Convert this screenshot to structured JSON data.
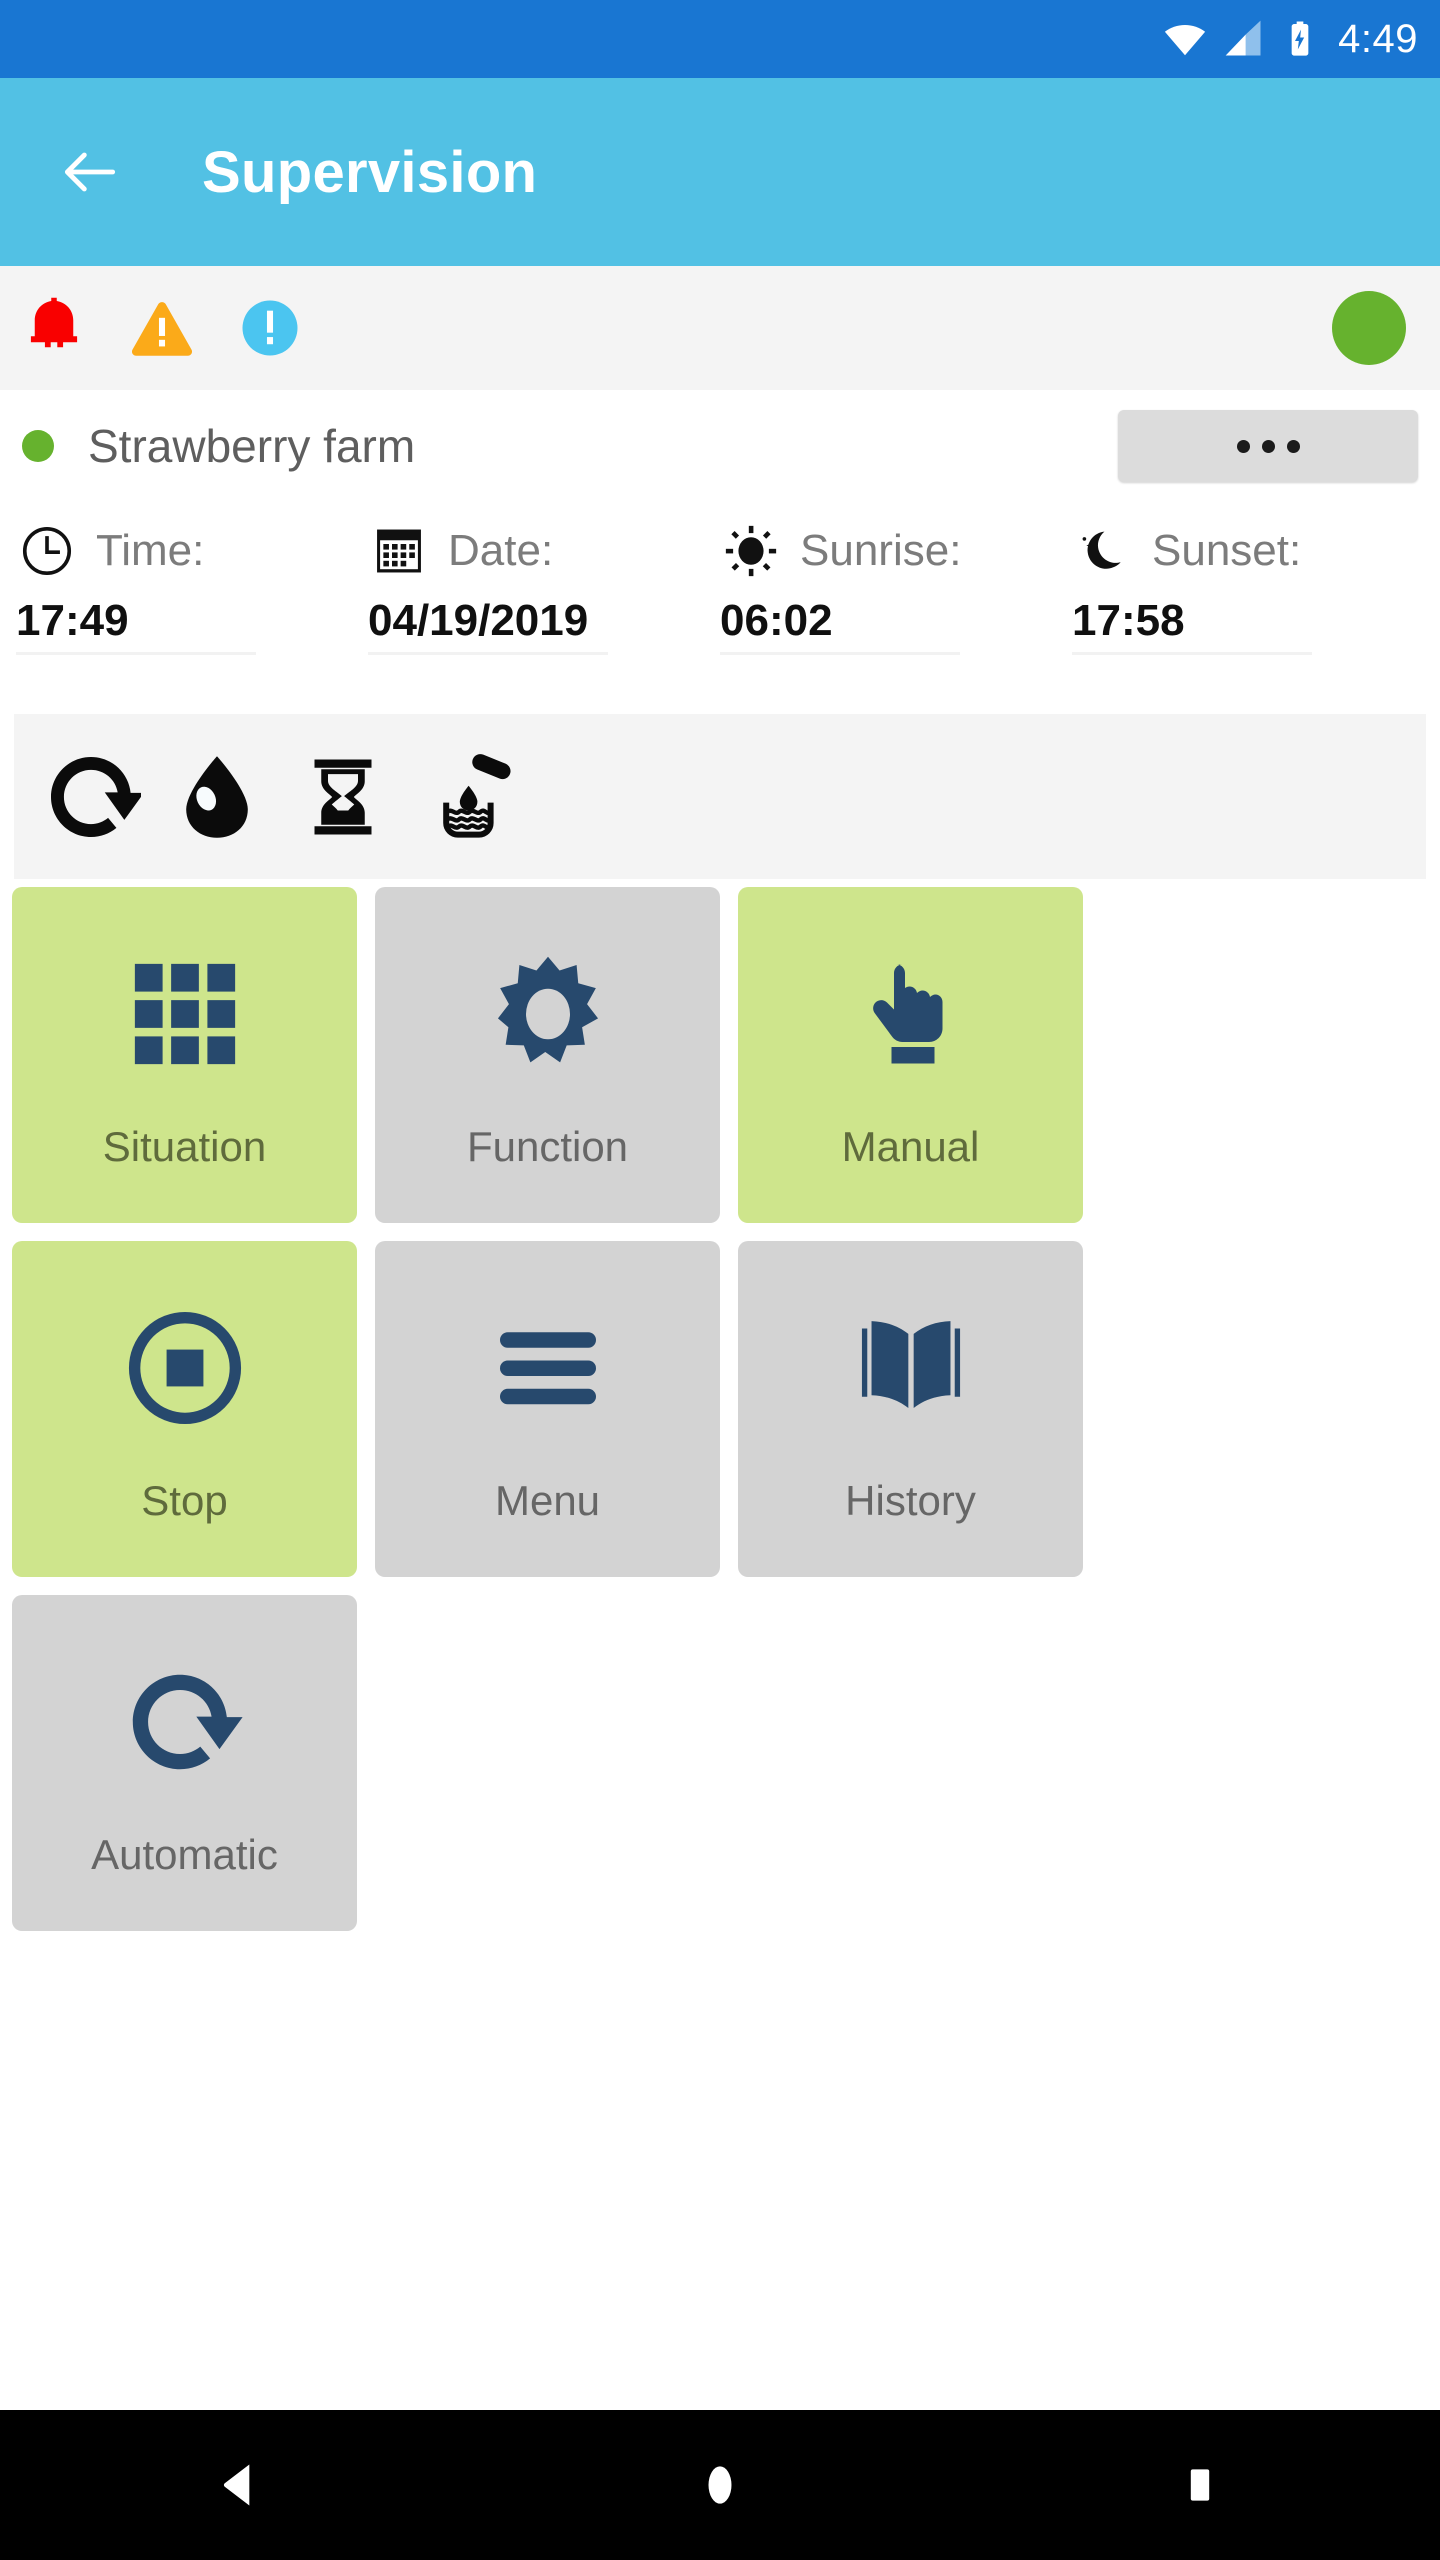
{
  "status_bar": {
    "time": "4:49",
    "icons": [
      "wifi-icon",
      "cellular-signal-icon",
      "battery-charging-icon"
    ]
  },
  "app_bar": {
    "title": "Supervision",
    "back_icon": "back-arrow-icon"
  },
  "alert_bar": {
    "alerts": [
      {
        "name": "alarm-bell-icon",
        "color": "#F90000"
      },
      {
        "name": "warning-triangle-icon",
        "color": "#FBAA19"
      },
      {
        "name": "info-circle-icon",
        "color": "#4BC5F0"
      }
    ],
    "status_indicator": {
      "name": "status-dot-green",
      "color": "#66B22E"
    }
  },
  "site": {
    "name": "Strawberry farm",
    "status_color": "#66B22E",
    "more_button_label": "..."
  },
  "info": [
    {
      "icon": "clock-icon",
      "label": "Time:",
      "value": "17:49"
    },
    {
      "icon": "calendar-icon",
      "label": "Date:",
      "value": "04/19/2019"
    },
    {
      "icon": "sun-icon",
      "label": "Sunrise:",
      "value": "06:02"
    },
    {
      "icon": "moon-icon",
      "label": "Sunset:",
      "value": "17:58"
    }
  ],
  "mode_strip": {
    "icons": [
      "refresh-cycle-icon",
      "water-drop-icon",
      "hourglass-icon",
      "dosing-pipette-icon"
    ]
  },
  "tiles": [
    {
      "label": "Situation",
      "icon": "grid-squares-icon",
      "state": "green"
    },
    {
      "label": "Function",
      "icon": "gear-icon",
      "state": "grey"
    },
    {
      "label": "Manual",
      "icon": "pointing-hand-icon",
      "state": "green"
    },
    {
      "label": "Stop",
      "icon": "stop-circle-icon",
      "state": "green"
    },
    {
      "label": "Menu",
      "icon": "hamburger-menu-icon",
      "state": "grey"
    },
    {
      "label": "History",
      "icon": "open-book-icon",
      "state": "grey"
    },
    {
      "label": "Automatic",
      "icon": "refresh-cycle-icon",
      "state": "grey"
    }
  ],
  "nav_bar": {
    "back": "nav-back-icon",
    "home": "nav-home-icon",
    "recents": "nav-recents-icon"
  },
  "colors": {
    "status_bar": "#1976D2",
    "app_bar": "#52C1E4",
    "tile_active": "#CEE58C",
    "tile_inactive": "#D3D3D3",
    "tile_icon": "#27496D",
    "green": "#66B22E"
  }
}
